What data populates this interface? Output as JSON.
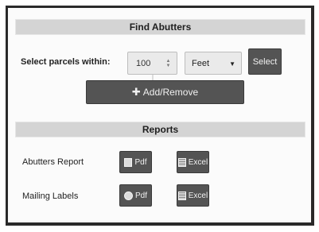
{
  "find_abutters": {
    "title": "Find Abutters",
    "select_label": "Select parcels within:",
    "distance_value": "100",
    "unit_selected": "Feet",
    "select_button": "Select",
    "add_remove_button": "Add/Remove"
  },
  "reports": {
    "title": "Reports",
    "rows": [
      {
        "label": "Abutters Report",
        "pdf_label": "Pdf",
        "excel_label": "Excel"
      },
      {
        "label": "Mailing Labels",
        "pdf_label": "Pdf",
        "excel_label": "Excel"
      }
    ]
  },
  "icons": [
    "spinner-arrows-icon",
    "chevron-down-icon",
    "plus-icon",
    "pdf-icon",
    "excel-icon",
    "mail-icon"
  ]
}
